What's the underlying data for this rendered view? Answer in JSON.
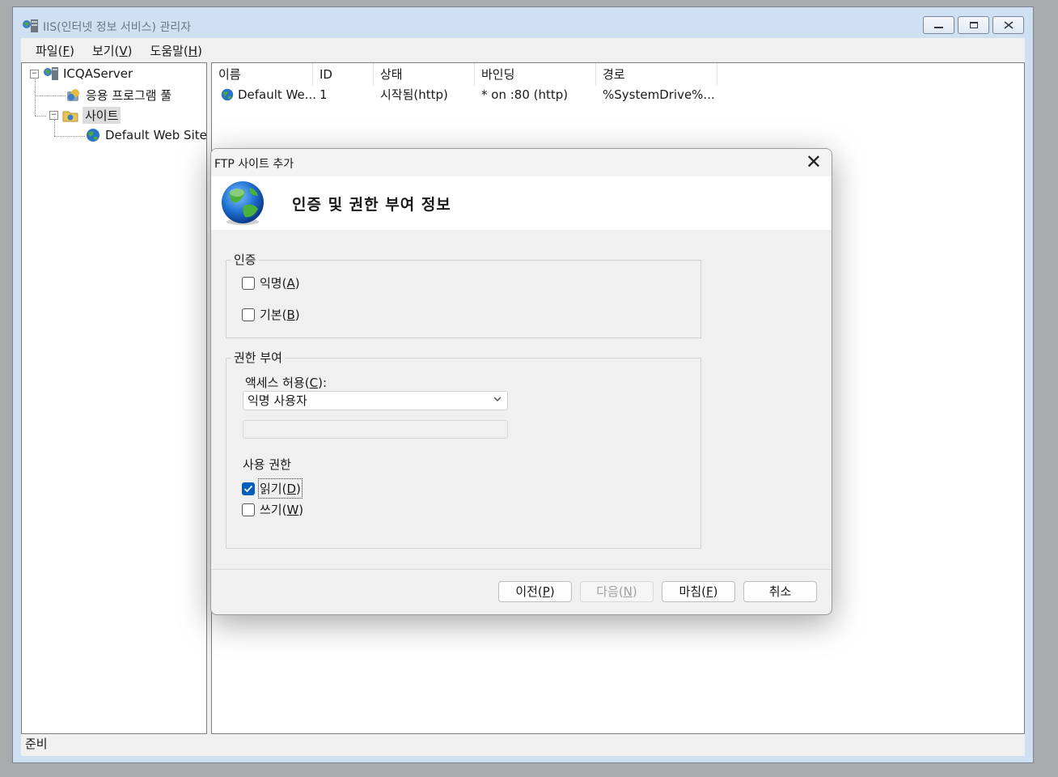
{
  "window": {
    "title": "IIS(인터넷 정보 서비스) 관리자"
  },
  "menu": [
    "파일(F)",
    "보기(V)",
    "도움말(H)"
  ],
  "tree": {
    "server": "ICQAServer",
    "app_pool": "응용 프로그램 풀",
    "sites": "사이트",
    "default_site": "Default Web Site"
  },
  "list": {
    "columns": [
      "이름",
      "ID",
      "상태",
      "바인딩",
      "경로"
    ],
    "rows": [
      {
        "name": "Default We...",
        "id": "1",
        "status": "시작됨(http)",
        "binding": "* on :80 (http)",
        "path": "%SystemDrive%..."
      }
    ]
  },
  "status_bar": "준비",
  "dialog": {
    "title": "FTP 사이트 추가",
    "heading": "인증 및 권한 부여 정보",
    "auth_group": "인증",
    "anonymous": "익명(A)",
    "basic": "기본(B)",
    "authz_group": "권한 부여",
    "access_label": "액세스 허용(C):",
    "access_value": "익명 사용자",
    "perm_label": "사용 권한",
    "read": "읽기(D)",
    "write": "쓰기(W)",
    "read_checked": true,
    "buttons": {
      "prev": "이전(P)",
      "next": "다음(N)",
      "finish": "마침(F)",
      "cancel": "취소"
    }
  },
  "colors": {
    "accent": "#005fb8",
    "frame": "#cfe0f3"
  }
}
